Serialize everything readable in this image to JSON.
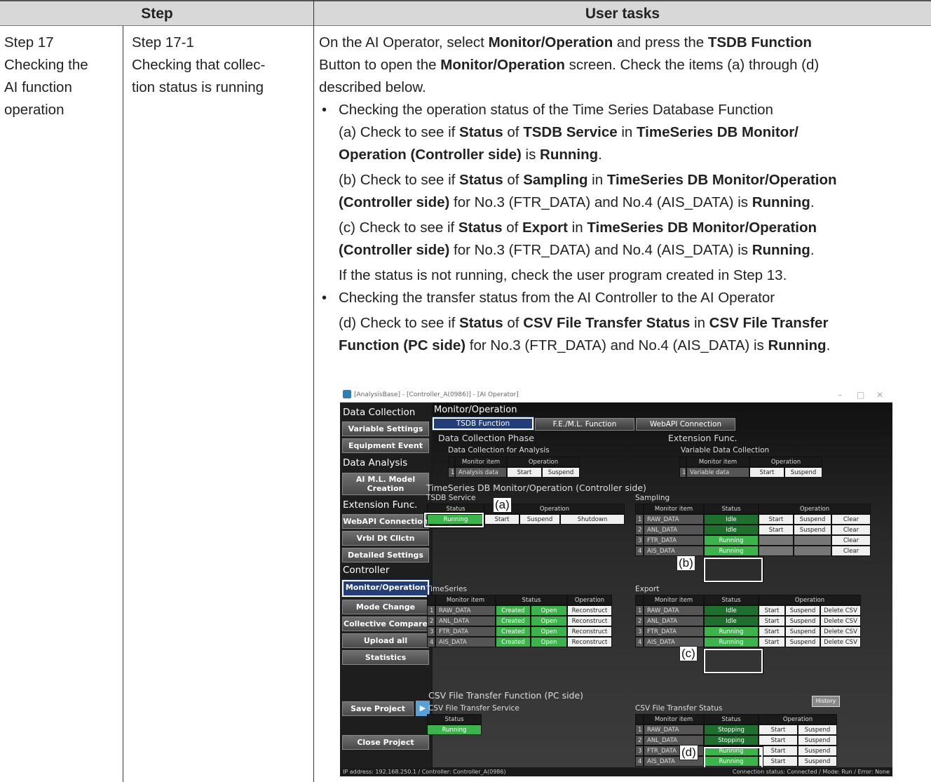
{
  "table": {
    "header_step": "Step",
    "header_tasks": "User tasks",
    "step_col1": [
      "Step 17",
      "Checking the",
      "AI function",
      "operation"
    ],
    "step_col2": [
      "Step 17-1",
      "Checking that collec-",
      "tion status is running"
    ]
  },
  "tasks": {
    "p1a": "On the AI Operator, select ",
    "p1b": "Monitor/Operation",
    "p1c": " and press the ",
    "p1d": "TSDB Function",
    "p2a": "Button to open the ",
    "p2b": "Monitor/Operation",
    "p2c": " screen. Check the items (a) through (d)",
    "p3": "described below.",
    "bullet": "•",
    "b1": "Checking the operation status of the Time Series Database Function",
    "a1": "(a) Check to see if ",
    "a2": "Status",
    "a3": " of ",
    "a4": "TSDB Service",
    "a5": " in ",
    "a6": "TimeSeries DB Monitor/",
    "a7": "Operation (Controller side)",
    "a8": " is ",
    "a9": "Running",
    "a10": ".",
    "bb1": "(b) Check to see if ",
    "bb2": "Status",
    "bb3": " of ",
    "bb4": "Sampling",
    "bb5": " in ",
    "bb6": "TimeSeries DB Monitor/Operation",
    "bb7": "(Controller side)",
    "bb8": " for No.3 (FTR_DATA) and No.4 (AIS_DATA) is ",
    "bb9": "Running",
    "bb10": ".",
    "c1": "(c) Check to see if ",
    "c2": "Status",
    "c3": " of ",
    "c4": "Export",
    "c5": " in ",
    "c6": "TimeSeries DB Monitor/Operation",
    "c7": "(Controller side)",
    "c8": " for No.3 (FTR_DATA) and No.4 (AIS_DATA) is ",
    "c9": "Running",
    "c10": ".",
    "note": "If the status is not running, check the user program created in Step 13.",
    "b2": "Checking the transfer status from the AI Controller to the AI Operator",
    "d1": "(d) Check to see if ",
    "d2": "Status",
    "d3": " of ",
    "d4": "CSV File Transfer Status",
    "d5": " in ",
    "d6": "CSV File Transfer",
    "d7": "Function (PC side)",
    "d8": " for No.3 (FTR_DATA) and No.4 (AIS_DATA) is ",
    "d9": "Running",
    "d10": "."
  },
  "screen": {
    "window_title": "[AnalysisBase] - [Controller_A(0986)] - [AI Operator]",
    "win_min": "–",
    "win_max": "□",
    "win_close": "✕",
    "side": {
      "data_collection": "Data Collection",
      "variable_settings": "Variable Settings",
      "equipment_event": "Equipment Event",
      "data_analysis": "Data Analysis",
      "ai_ml_model_1": "AI M.L. Model",
      "ai_ml_model_2": "Creation",
      "extension_func": "Extension Func.",
      "webapi_connection": "WebAPI Connection",
      "vrbl_dt_cllctn": "Vrbl Dt Cllctn",
      "detailed_settings": "Detailed Settings",
      "controller": "Controller",
      "monitor_operation": "Monitor/Operation",
      "mode_change": "Mode Change",
      "collective_compare": "Collective Compare",
      "upload_all": "Upload all",
      "statistics": "Statistics",
      "save_project": "Save Project",
      "save_arrow": "▶",
      "close_project": "Close Project"
    },
    "main_title": "Monitor/Operation",
    "tabs": [
      "TSDB Function",
      "F.E./M.L. Function",
      "WebAPI Connection"
    ],
    "dc_phase": "Data Collection Phase",
    "dc_for_analysis": "Data Collection for Analysis",
    "ext_func": "Extension Func.",
    "var_data_collection": "Variable Data Collection",
    "col_monitor_item": "Monitor item",
    "col_operation": "Operation",
    "col_status": "Status",
    "analysis_row": {
      "num": "1",
      "item": "Analysis data",
      "start": "Start",
      "suspend": "Suspend"
    },
    "variable_row": {
      "num": "1",
      "item": "Variable data",
      "start": "Start",
      "suspend": "Suspend"
    },
    "tsdb_monitor_title": "TimeSeries DB Monitor/Operation (Controller side)",
    "tsdb_service": "TSDB Service",
    "tsdb_service_status": "Running",
    "btn_start": "Start",
    "btn_suspend": "Suspend",
    "btn_shutdown": "Shutdown",
    "btn_clear": "Clear",
    "btn_reconstruct": "Reconstruct",
    "btn_delete_csv": "Delete CSV",
    "sampling": "Sampling",
    "sampling_rows": [
      {
        "num": "1",
        "item": "RAW_DATA",
        "status": "Idle"
      },
      {
        "num": "2",
        "item": "ANL_DATA",
        "status": "Idle"
      },
      {
        "num": "3",
        "item": "FTR_DATA",
        "status": "Running"
      },
      {
        "num": "4",
        "item": "AIS_DATA",
        "status": "Running"
      }
    ],
    "timeseries": "TimeSeries",
    "ts_rows": [
      {
        "num": "1",
        "item": "RAW_DATA",
        "s1": "Created",
        "s2": "Open"
      },
      {
        "num": "2",
        "item": "ANL_DATA",
        "s1": "Created",
        "s2": "Open"
      },
      {
        "num": "3",
        "item": "FTR_DATA",
        "s1": "Created",
        "s2": "Open"
      },
      {
        "num": "4",
        "item": "AIS_DATA",
        "s1": "Created",
        "s2": "Open"
      }
    ],
    "export": "Export",
    "export_rows": [
      {
        "num": "1",
        "item": "RAW_DATA",
        "status": "Idle"
      },
      {
        "num": "2",
        "item": "ANL_DATA",
        "status": "Idle"
      },
      {
        "num": "3",
        "item": "FTR_DATA",
        "status": "Running"
      },
      {
        "num": "4",
        "item": "AIS_DATA",
        "status": "Running"
      }
    ],
    "csv_title": "CSV File Transfer Function (PC side)",
    "history": "History",
    "csv_service": "CSV File Transfer Service",
    "csv_service_status": "Running",
    "csv_status": "CSV File Transfer Status",
    "csv_rows": [
      {
        "num": "1",
        "item": "RAW_DATA",
        "status": "Stopping"
      },
      {
        "num": "2",
        "item": "ANL_DATA",
        "status": "Stopping"
      },
      {
        "num": "3",
        "item": "FTR_DATA",
        "status": "Running"
      },
      {
        "num": "4",
        "item": "AIS_DATA",
        "status": "Running"
      }
    ],
    "labels": {
      "a": "(a)",
      "b": "(b)",
      "c": "(c)",
      "d": "(d)"
    },
    "status_left": "IP address: 192.168.250.1 / Controller: Controller_A(0986)",
    "status_right": "Connection status: Connected / Mode: Run / Error: None"
  },
  "colors": {
    "running_green": "#3cb44b",
    "active_blue": "#233d78"
  }
}
